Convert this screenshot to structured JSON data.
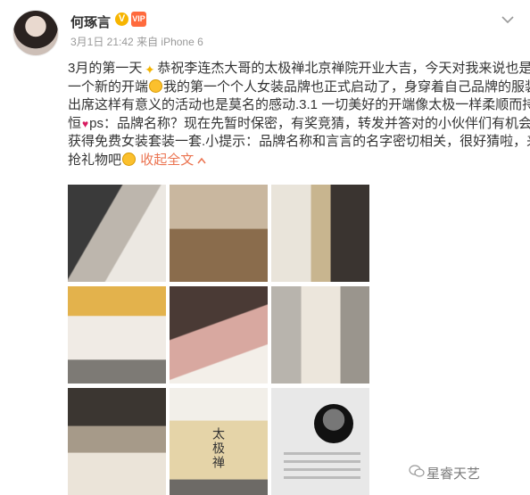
{
  "post": {
    "author": {
      "name": "何琢言",
      "verified_badge": "V",
      "member_badge": "VIP"
    },
    "meta": {
      "time": "3月1日 21:42",
      "source": "来自 iPhone 6"
    },
    "text_lines": [
      "3月的第一天",
      "恭祝李连杰大哥的太极禅北京禅院开业大吉，今天对我来说也是",
      "一个新的开端",
      "我的第一个个人女装品牌也正式启动了，身穿着自己品牌的服装",
      "出席这样有意义的活动也是莫名的感动.3.1 一切美好的开端像太极一样柔顺而持",
      "恒",
      "ps：品牌名称？现在先暂时保密，有奖竞猜，转发并答对的小伙伴们有机会",
      "获得免费女装套装一套.小提示：品牌名称和言言的名字密切相关，很好猜啦，来",
      "抢礼物吧"
    ],
    "collapse_label": "收起全文",
    "lantern_text": "太极禅",
    "emoji": [
      "sparkle",
      "smile",
      "heart",
      "grin"
    ]
  },
  "photos": [
    {
      "alt": "photo-1"
    },
    {
      "alt": "photo-2"
    },
    {
      "alt": "photo-3"
    },
    {
      "alt": "photo-4"
    },
    {
      "alt": "photo-5"
    },
    {
      "alt": "photo-6"
    },
    {
      "alt": "photo-7"
    },
    {
      "alt": "photo-8"
    },
    {
      "alt": "photo-9"
    }
  ],
  "watermark": {
    "text": "星睿天艺"
  },
  "colors": {
    "link": "#eb7350",
    "meta": "#999999",
    "text": "#333333"
  }
}
